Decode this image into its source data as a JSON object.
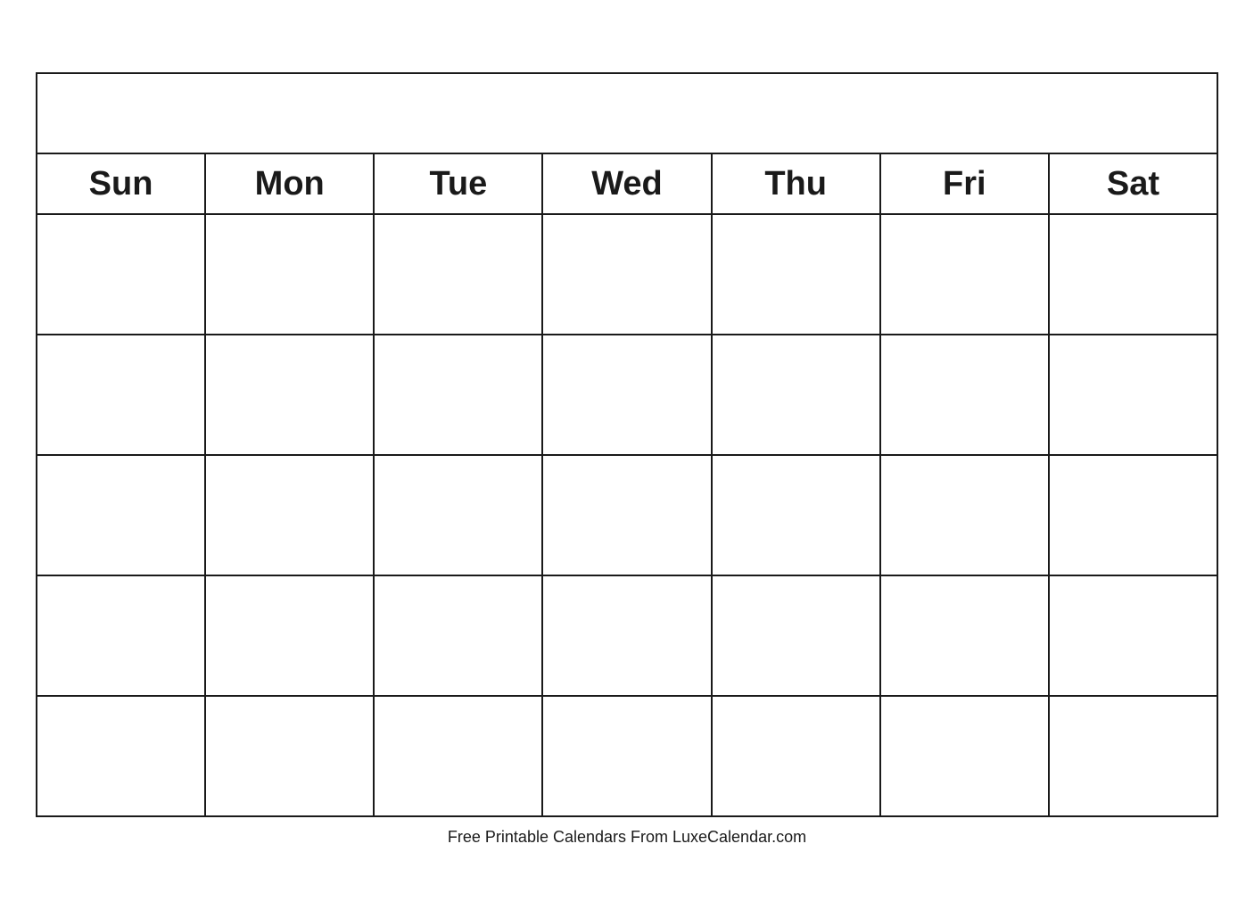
{
  "calendar": {
    "title": "",
    "days": [
      "Sun",
      "Mon",
      "Tue",
      "Wed",
      "Thu",
      "Fri",
      "Sat"
    ],
    "rows": 5,
    "footer": "Free Printable Calendars From LuxeCalendar.com"
  }
}
